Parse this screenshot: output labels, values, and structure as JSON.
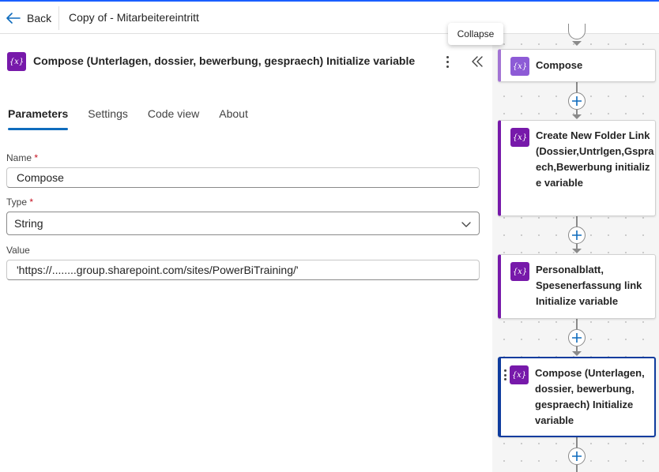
{
  "header": {
    "back_label": "Back",
    "flow_title": "Copy of - Mitarbeitereintritt"
  },
  "tooltip": {
    "text": "Collapse"
  },
  "panel": {
    "icon": "variable-icon",
    "title": "Compose (Unterlagen, dossier, bewerbung, gespraech) Initialize variable",
    "tabs": [
      {
        "label": "Parameters",
        "active": true
      },
      {
        "label": "Settings",
        "active": false
      },
      {
        "label": "Code view",
        "active": false
      },
      {
        "label": "About",
        "active": false
      }
    ],
    "fields": {
      "name": {
        "label": "Name",
        "required_mark": "*",
        "value": "Compose"
      },
      "type": {
        "label": "Type",
        "required_mark": "*",
        "value": "String"
      },
      "value": {
        "label": "Value",
        "value": "'https://........group.sharepoint.com/sites/PowerBiTraining/'"
      }
    }
  },
  "flow": {
    "cards": [
      {
        "title": "Compose",
        "icon": "variable-icon",
        "selected": false
      },
      {
        "title": "Create New Folder Link (Dossier,Untrlgen,Gspraech,Bewerbung initialize variable",
        "icon": "variable-icon",
        "selected": false
      },
      {
        "title": "Personalblatt, Spesenerfassung link Initialize variable",
        "icon": "variable-icon",
        "selected": false
      },
      {
        "title": "Compose (Unterlagen, dossier, bewerbung, gespraech) Initialize variable",
        "icon": "variable-icon",
        "selected": true
      }
    ]
  },
  "colors": {
    "accent": "#0f6cbd",
    "variable_icon": "#7719aa",
    "selected_border": "#0f3c9e",
    "top_border": "#1a5fff"
  }
}
